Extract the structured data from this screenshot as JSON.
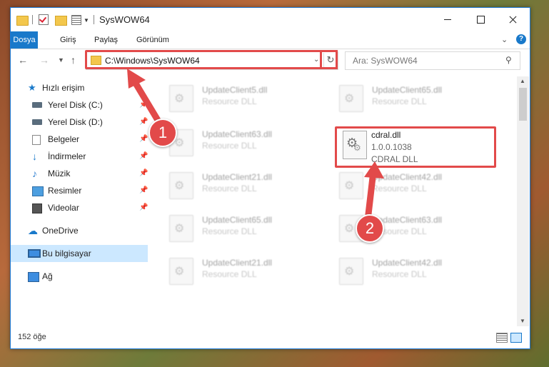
{
  "window": {
    "title": "SysWOW64"
  },
  "ribbon": {
    "tabs": [
      "Dosya",
      "Giriş",
      "Paylaş",
      "Görünüm"
    ]
  },
  "navigation": {
    "address": "C:\\Windows\\SysWOW64",
    "search_placeholder": "Ara: SysWOW64"
  },
  "sidebar": {
    "items": [
      {
        "label": "Hızlı erişim",
        "icon": "star-icon"
      },
      {
        "label": "Yerel Disk (C:)",
        "icon": "drive-icon",
        "pinned": true
      },
      {
        "label": "Yerel Disk (D:)",
        "icon": "drive-icon",
        "pinned": true
      },
      {
        "label": "Belgeler",
        "icon": "documents-icon",
        "pinned": true
      },
      {
        "label": "İndirmeler",
        "icon": "downloads-icon",
        "pinned": true
      },
      {
        "label": "Müzik",
        "icon": "music-icon",
        "pinned": true
      },
      {
        "label": "Resimler",
        "icon": "pictures-icon",
        "pinned": true
      },
      {
        "label": "Videolar",
        "icon": "videos-icon",
        "pinned": true
      },
      {
        "label": "OneDrive",
        "icon": "cloud-icon"
      },
      {
        "label": "Bu bilgisayar",
        "icon": "computer-icon",
        "selected": true
      },
      {
        "label": "Ağ",
        "icon": "network-icon"
      }
    ]
  },
  "files": [
    {
      "name": "UpdateClient5.dll",
      "type": "Resource DLL"
    },
    {
      "name": "UpdateClient65.dll",
      "type": "Resource DLL"
    },
    {
      "name": "UpdateClient63.dll",
      "type": "Resource DLL"
    },
    {
      "name": "UpdateClient21.dll",
      "type": "Resource DLL"
    },
    {
      "name": "UpdateClient42.dll",
      "type": "Resource DLL"
    },
    {
      "name": "UpdateClient65.dll",
      "type": "Resource DLL"
    },
    {
      "name": "UpdateClient63.dll",
      "type": "Resource DLL"
    },
    {
      "name": "UpdateClient21.dll",
      "type": "Resource DLL"
    },
    {
      "name": "UpdateClient42.dll",
      "type": "Resource DLL"
    }
  ],
  "target_file": {
    "name": "cdral.dll",
    "version": "1.0.0.1038",
    "type": "CDRAL DLL"
  },
  "status": {
    "item_count": "152 öğe"
  },
  "callouts": [
    "1",
    "2"
  ],
  "colors": {
    "accent": "#1979ca",
    "highlight": "#e24a4a"
  }
}
